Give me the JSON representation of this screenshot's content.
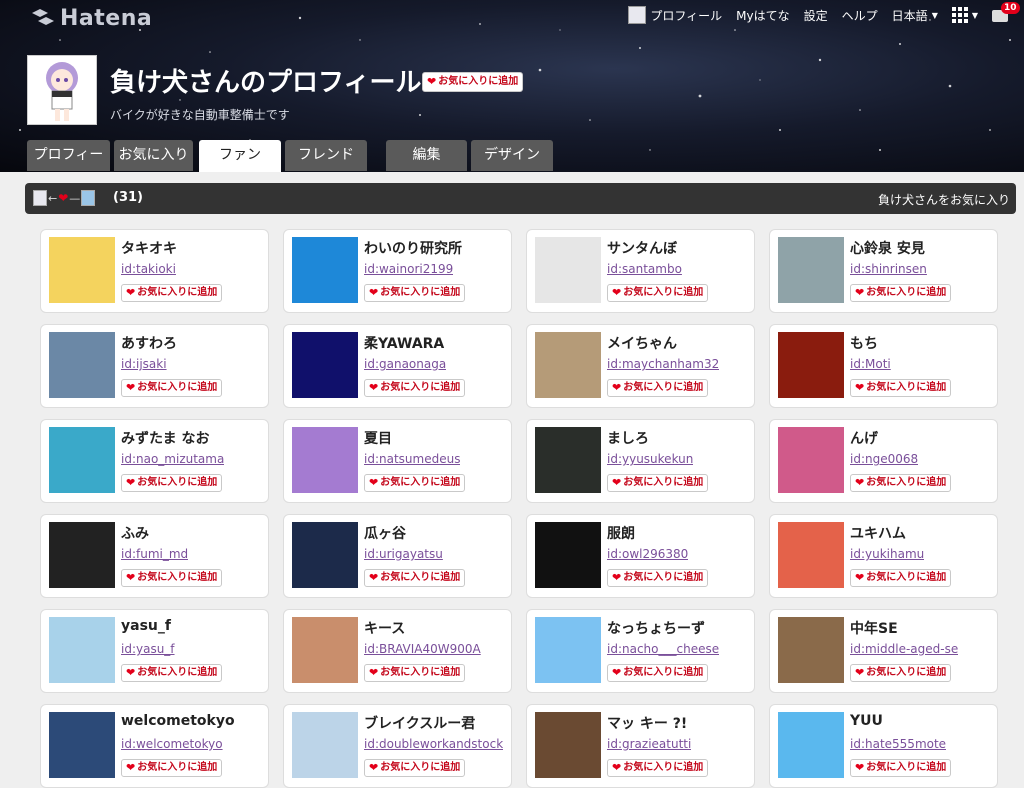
{
  "header": {
    "logo_text": "Hatena",
    "title": "負け犬さんのプロフィール",
    "tagline": "バイクが好きな自動車整備士です",
    "fav_button": "お気に入りに追加"
  },
  "topnav": {
    "profile": "プロフィール",
    "my_hatena": "Myはてな",
    "settings": "設定",
    "help": "ヘルプ",
    "language": "日本語",
    "notification_count": "10"
  },
  "tabs": [
    {
      "label": "プロフィール"
    },
    {
      "label": "お気に入り"
    },
    {
      "label": "ファン",
      "active": true
    },
    {
      "label": "フレンド"
    },
    {
      "label": "編集"
    },
    {
      "label": "デザイン"
    }
  ],
  "fanbar": {
    "count": "(31)",
    "right_link": "負け犬さんをお気に入り"
  },
  "fav_label": "お気に入りに追加",
  "fans": [
    {
      "name": "タキオキ",
      "id": "id:takioki",
      "color": "#f4d35e"
    },
    {
      "name": "わいのり研究所",
      "id": "id:wainori2199",
      "color": "#1e88d8"
    },
    {
      "name": "サンタんぼ",
      "id": "id:santambo",
      "color": "#e6e6e6"
    },
    {
      "name": "心鈴泉 安見",
      "id": "id:shinrinsen",
      "color": "#8fa3a8"
    },
    {
      "name": "あすわろ",
      "id": "id:ijsaki",
      "color": "#6b88a6"
    },
    {
      "name": "柔YAWARA",
      "id": "id:ganaonaga",
      "color": "#10106b"
    },
    {
      "name": "メイちゃん",
      "id": "id:maychanham32",
      "color": "#b59b78"
    },
    {
      "name": "もち",
      "id": "id:Moti",
      "color": "#8a1c0e"
    },
    {
      "name": "みずたま なお",
      "id": "id:nao_mizutama",
      "color": "#3aa9c9"
    },
    {
      "name": "夏目",
      "id": "id:natsumedeus",
      "color": "#a47bd1"
    },
    {
      "name": "ましろ",
      "id": "id:yyusukekun",
      "color": "#2a2e2a"
    },
    {
      "name": "んげ",
      "id": "id:nge0068",
      "color": "#d05a8a"
    },
    {
      "name": "ふみ",
      "id": "id:fumi_md",
      "color": "#222222"
    },
    {
      "name": "瓜ヶ谷",
      "id": "id:urigayatsu",
      "color": "#1c2a4a"
    },
    {
      "name": "服朗",
      "id": "id:owl296380",
      "color": "#111111"
    },
    {
      "name": "ユキハム",
      "id": "id:yukihamu",
      "color": "#e4624a"
    },
    {
      "name": "yasu_f",
      "id": "id:yasu_f",
      "color": "#a8d2ea"
    },
    {
      "name": "キース",
      "id": "id:BRAVIA40W900A",
      "color": "#c98e6c"
    },
    {
      "name": "なっちょちーず",
      "id": "id:nacho___cheese",
      "color": "#7cc2f2"
    },
    {
      "name": "中年SE",
      "id": "id:middle-aged-se",
      "color": "#8a6a4a"
    },
    {
      "name": "welcometokyo",
      "id": "id:welcometokyo",
      "color": "#2c4a78"
    },
    {
      "name": "ブレイクスルー君",
      "id": "id:doubleworkandstock",
      "color": "#bcd4e8"
    },
    {
      "name": "マッ キー ?!",
      "id": "id:grazieatutti",
      "color": "#6a4a32"
    },
    {
      "name": "YUU",
      "id": "id:hate555mote",
      "color": "#5ab8ee"
    }
  ]
}
